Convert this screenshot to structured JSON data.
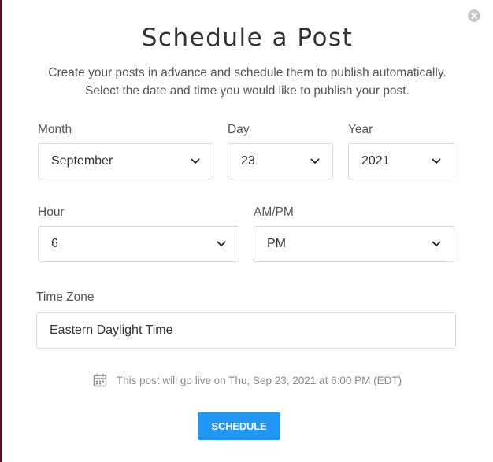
{
  "dialog": {
    "title": "Schedule a Post",
    "subtitle_line1": "Create your posts in advance and schedule them to publish automatically.",
    "subtitle_line2": "Select the date and time you would like to publish your post."
  },
  "fields": {
    "month": {
      "label": "Month",
      "value": "September"
    },
    "day": {
      "label": "Day",
      "value": "23"
    },
    "year": {
      "label": "Year",
      "value": "2021"
    },
    "hour": {
      "label": "Hour",
      "value": "6"
    },
    "ampm": {
      "label": "AM/PM",
      "value": "PM"
    },
    "timezone": {
      "label": "Time Zone",
      "value": "Eastern Daylight Time"
    }
  },
  "summary": "This post will go live on Thu, Sep 23, 2021 at 6:00 PM (EDT)",
  "schedule_label": "SCHEDULE",
  "icons": {
    "close": "close-icon",
    "chevron": "chevron-down-icon",
    "calendar": "calendar-icon"
  },
  "colors": {
    "primary": "#2196f3",
    "border": "#d9d9d9",
    "backdrop": "#5a1020"
  }
}
